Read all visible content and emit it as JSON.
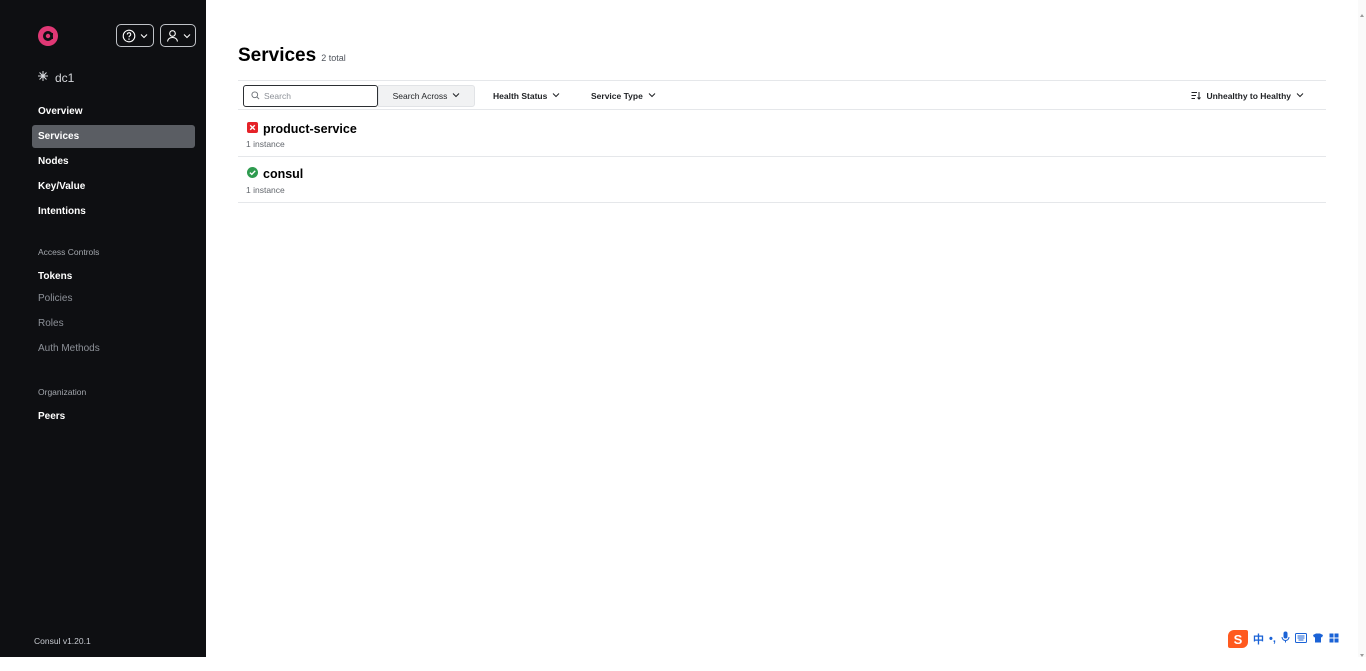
{
  "sidebar": {
    "datacenter": "dc1",
    "nav": [
      {
        "label": "Overview"
      },
      {
        "label": "Services"
      },
      {
        "label": "Nodes"
      },
      {
        "label": "Key/Value"
      },
      {
        "label": "Intentions"
      }
    ],
    "access_controls_heading": "Access Controls",
    "access_controls": [
      {
        "label": "Tokens"
      },
      {
        "label": "Policies"
      },
      {
        "label": "Roles"
      },
      {
        "label": "Auth Methods"
      }
    ],
    "organization_heading": "Organization",
    "organization": [
      {
        "label": "Peers"
      }
    ],
    "version": "Consul v1.20.1"
  },
  "main": {
    "title": "Services",
    "total": "2 total",
    "search": {
      "placeholder": "Search",
      "value": ""
    },
    "search_across_label": "Search Across",
    "health_status_label": "Health Status",
    "service_type_label": "Service Type",
    "sort_label": "Unhealthy to Healthy",
    "services": [
      {
        "name": "product-service",
        "meta": "1 instance",
        "status": "critical",
        "status_color": "#e52228"
      },
      {
        "name": "consul",
        "meta": "1 instance",
        "status": "passing",
        "status_color": "#2e9b4f"
      }
    ]
  },
  "colors": {
    "sidebar_bg": "#0e0f12",
    "active_nav_bg": "#5a5d63",
    "brand_pink": "#e03875"
  },
  "icons": {
    "logo": "consul-logo-icon",
    "help": "help-icon",
    "user": "user-icon",
    "datacenter": "datacenter-icon",
    "search": "search-icon",
    "sort": "sort-icon",
    "chevron": "chevron-down-icon",
    "critical": "x-square-icon",
    "passing": "check-circle-icon"
  }
}
